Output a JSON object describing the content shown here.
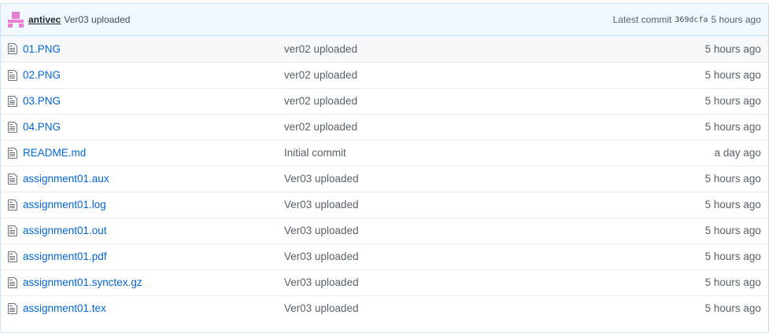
{
  "commit": {
    "author": "antivec",
    "message": "Ver03 uploaded",
    "latest_label": "Latest commit",
    "sha": "369dcfa",
    "age": "5 hours ago",
    "avatar_color": "#e87fd0"
  },
  "files": [
    {
      "name": "01.PNG",
      "message": "ver02 uploaded",
      "age": "5 hours ago",
      "icon": "file-icon"
    },
    {
      "name": "02.PNG",
      "message": "ver02 uploaded",
      "age": "5 hours ago",
      "icon": "file-icon"
    },
    {
      "name": "03.PNG",
      "message": "ver02 uploaded",
      "age": "5 hours ago",
      "icon": "file-icon"
    },
    {
      "name": "04.PNG",
      "message": "ver02 uploaded",
      "age": "5 hours ago",
      "icon": "file-icon"
    },
    {
      "name": "README.md",
      "message": "Initial commit",
      "age": "a day ago",
      "icon": "file-icon"
    },
    {
      "name": "assignment01.aux",
      "message": "Ver03 uploaded",
      "age": "5 hours ago",
      "icon": "file-icon"
    },
    {
      "name": "assignment01.log",
      "message": "Ver03 uploaded",
      "age": "5 hours ago",
      "icon": "file-icon"
    },
    {
      "name": "assignment01.out",
      "message": "Ver03 uploaded",
      "age": "5 hours ago",
      "icon": "file-icon"
    },
    {
      "name": "assignment01.pdf",
      "message": "Ver03 uploaded",
      "age": "5 hours ago",
      "icon": "file-icon"
    },
    {
      "name": "assignment01.synctex.gz",
      "message": "Ver03 uploaded",
      "age": "5 hours ago",
      "icon": "file-icon"
    },
    {
      "name": "assignment01.tex",
      "message": "Ver03 uploaded",
      "age": "5 hours ago",
      "icon": "file-icon"
    }
  ]
}
